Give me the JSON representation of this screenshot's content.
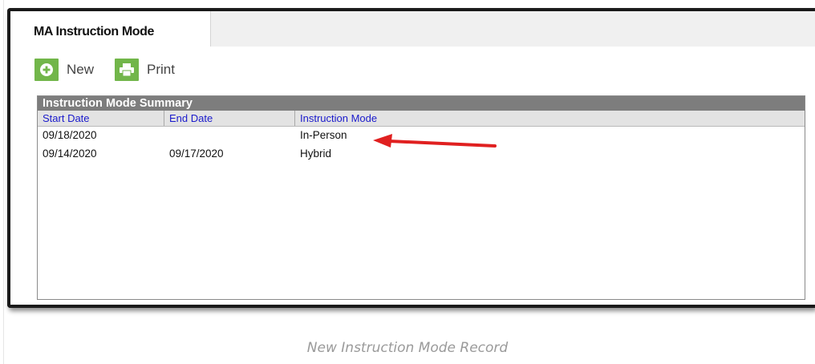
{
  "tab": {
    "label": "MA Instruction Mode"
  },
  "toolbar": {
    "new_label": "New",
    "print_label": "Print"
  },
  "grid": {
    "title": "Instruction Mode Summary",
    "columns": [
      "Start Date",
      "End Date",
      "Instruction Mode"
    ],
    "rows": [
      [
        "09/18/2020",
        "",
        "In-Person"
      ],
      [
        "09/14/2020",
        "09/17/2020",
        "Hybrid"
      ]
    ]
  },
  "annotation": {
    "arrow_color": "#e02020"
  },
  "caption": "New Instruction Mode Record",
  "colors": {
    "accent_green": "#72b64a",
    "header_link": "#1a1acc",
    "title_bar": "#7d7d7d"
  }
}
